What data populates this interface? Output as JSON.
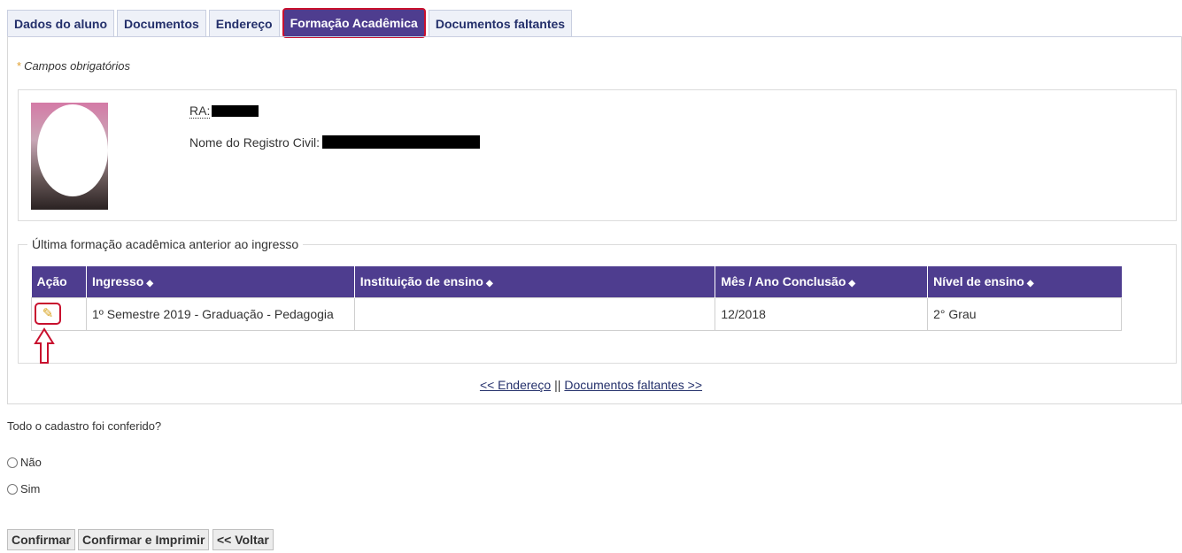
{
  "tabs": [
    {
      "label": "Dados do aluno",
      "active": false
    },
    {
      "label": "Documentos",
      "active": false
    },
    {
      "label": "Endereço",
      "active": false
    },
    {
      "label": "Formação Acadêmica",
      "active": true
    },
    {
      "label": "Documentos faltantes",
      "active": false
    }
  ],
  "required_note": {
    "star": "*",
    "text": "Campos obrigatórios"
  },
  "student": {
    "ra_label": "RA:",
    "name_label": "Nome do Registro Civil:"
  },
  "formation": {
    "legend": "Última formação acadêmica anterior ao ingresso",
    "columns": [
      "Ação",
      "Ingresso",
      "Instituição de ensino",
      "Mês / Ano Conclusão",
      "Nível de ensino"
    ],
    "sort_icon": "◆",
    "rows": [
      {
        "ingresso": "1º Semestre 2019 - Graduação - Pedagogia",
        "instituicao": "",
        "conclusao": "12/2018",
        "nivel": "2° Grau"
      }
    ]
  },
  "pager": {
    "prev": "<< Endereço",
    "separator": "||",
    "next": "Documentos faltantes >>"
  },
  "confirmation": {
    "question": "Todo o cadastro foi conferido?",
    "options": [
      "Não",
      "Sim"
    ]
  },
  "buttons": {
    "confirm": "Confirmar",
    "confirm_print": "Confirmar e Imprimir",
    "back": "<< Voltar"
  },
  "colors": {
    "header_bg": "#4e3d8f",
    "highlight": "#c8102e",
    "link": "#24306b"
  }
}
